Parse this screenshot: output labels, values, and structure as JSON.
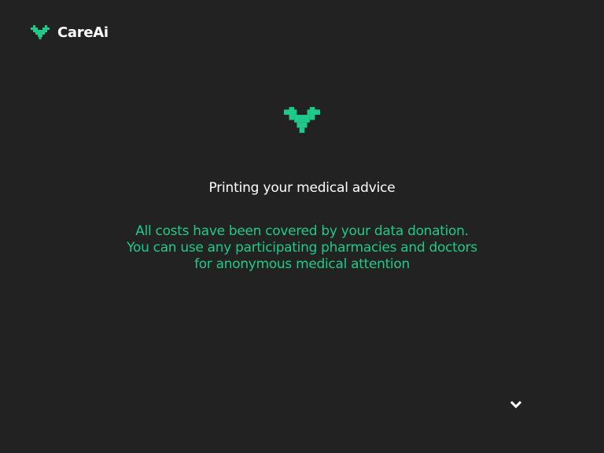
{
  "brand": {
    "name": "CareAi",
    "logo_icon": "pixel-heart-icon",
    "accent_color": "#1fc98a"
  },
  "status": {
    "icon": "pixel-heart-icon",
    "title": "Printing your medical advice"
  },
  "info": {
    "lines": [
      "All costs have been covered by your data donation.",
      "You can use any participating pharmacies and doctors",
      "for anonymous medical attention"
    ],
    "color": "#1fc98a"
  },
  "controls": {
    "scroll_icon": "chevron-down-icon"
  },
  "background_color": "#222222"
}
